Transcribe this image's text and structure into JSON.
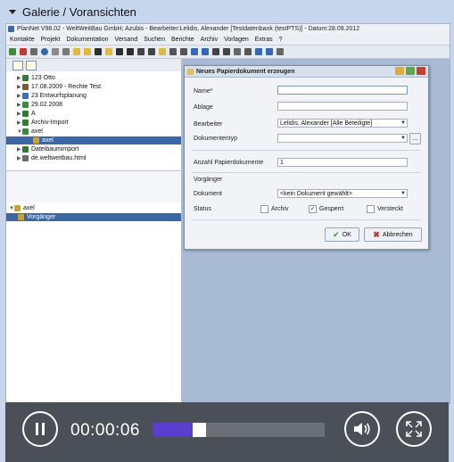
{
  "gallery": {
    "title": "Galerie / Voransichten"
  },
  "app": {
    "title": "PlanNet V98.02 - WeltWeitBau GmbH; Azubis - Bearbeiter:Lelidis, Alexander [Testdatenbank (testPTS)] - Datum:28.09.2012",
    "menu": [
      "Kontakte",
      "Projekt",
      "Dokumentation",
      "Versand",
      "Suchen",
      "Berichte",
      "Archiv",
      "Vorlagen",
      "Extras",
      "?"
    ]
  },
  "tree_top": [
    {
      "label": "123 Otto",
      "icon": "folder-icon",
      "color": "#2d7f2d"
    },
    {
      "label": "17.08.2009 - Rechte Test",
      "icon": "list-icon",
      "color": "#7a5b2e"
    },
    {
      "label": "23 Entwurfsplanung",
      "icon": "plan-icon",
      "color": "#3a6fc0"
    },
    {
      "label": "29.02.2008",
      "icon": "doc-icon",
      "color": "#3a8a3a"
    },
    {
      "label": "A",
      "icon": "folder-icon",
      "color": "#2d7f2d"
    },
    {
      "label": "Archiv-Import",
      "icon": "folder-icon",
      "color": "#2d7f2d"
    },
    {
      "label": "axel",
      "icon": "doc-icon",
      "color": "#3a8a3a"
    },
    {
      "label": "axel",
      "icon": "page-icon",
      "color": "#c7a23a"
    },
    {
      "label": "Dateibaumimport",
      "icon": "folder-icon",
      "color": "#2d7f2d"
    },
    {
      "label": "de.weltweitbau.html",
      "icon": "page-icon",
      "color": "#6b6b6b"
    }
  ],
  "tree_bottom": [
    {
      "label": "axel",
      "icon": "page-icon",
      "color": "#c7a23a"
    },
    {
      "label": "Vorgänger",
      "icon": "page-icon",
      "color": "#c7a23a"
    }
  ],
  "dialog": {
    "title": "Neues Papierdokument erzeugen",
    "name_label": "Name*",
    "name_value": "",
    "ablage_label": "Ablage",
    "ablage_value": "",
    "bearbeiter_label": "Bearbeiter",
    "bearbeiter_value": "Lelidis, Alexander [Alle Beteiligte]",
    "dokumententyp_label": "Dokumententyp",
    "dokumententyp_value": "",
    "more_button": "...",
    "anzahl_label": "Anzahl Papierdokumente",
    "anzahl_value": "1",
    "vorgaenger_heading": "Vorgänger",
    "dokument_label": "Dokument",
    "dokument_value": "<kein Dokument gewählt>",
    "status_label": "Status",
    "status_options": [
      {
        "label": "Archiv",
        "checked": false
      },
      {
        "label": "Gesperrt",
        "checked": true
      },
      {
        "label": "Versteckt",
        "checked": false
      }
    ],
    "ok_label": "OK",
    "cancel_label": "Abbrechen"
  },
  "player": {
    "time": "00:00:06",
    "progress": 0.23
  }
}
